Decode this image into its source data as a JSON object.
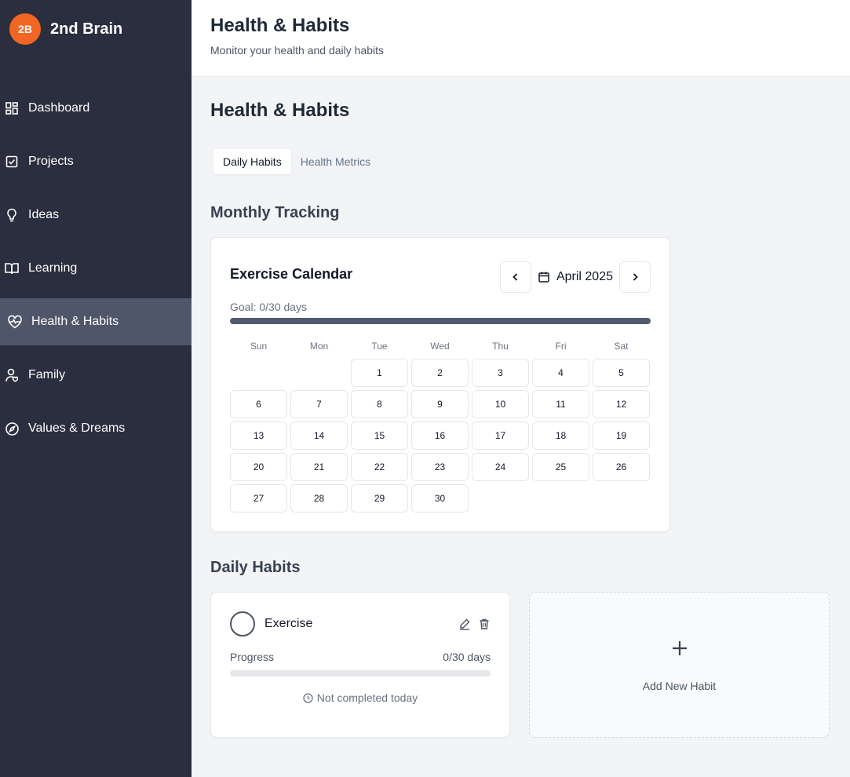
{
  "brand": {
    "logo_text": "2B",
    "name": "2nd Brain",
    "logo_color": "#f26522"
  },
  "sidebar": {
    "items": [
      {
        "label": "Dashboard",
        "icon": "dashboard-icon",
        "active": false
      },
      {
        "label": "Projects",
        "icon": "check-square-icon",
        "active": false
      },
      {
        "label": "Ideas",
        "icon": "lightbulb-icon",
        "active": false
      },
      {
        "label": "Learning",
        "icon": "book-open-icon",
        "active": false
      },
      {
        "label": "Health & Habits",
        "icon": "heart-pulse-icon",
        "active": true
      },
      {
        "label": "Family",
        "icon": "user-heart-icon",
        "active": false
      },
      {
        "label": "Values & Dreams",
        "icon": "compass-icon",
        "active": false
      }
    ]
  },
  "header": {
    "title": "Health & Habits",
    "subtitle": "Monitor your health and daily habits"
  },
  "main": {
    "title": "Health & Habits",
    "tabs": [
      {
        "label": "Daily Habits",
        "active": true
      },
      {
        "label": "Health Metrics",
        "active": false
      }
    ],
    "monthly_section_title": "Monthly Tracking",
    "daily_section_title": "Daily Habits"
  },
  "calendar": {
    "title": "Exercise Calendar",
    "month_label": "April 2025",
    "goal_text": "Goal: 0/30 days",
    "goal_progress": 1.0,
    "weekdays": [
      "Sun",
      "Mon",
      "Tue",
      "Wed",
      "Thu",
      "Fri",
      "Sat"
    ],
    "days": [
      "",
      "",
      "1",
      "2",
      "3",
      "4",
      "5",
      "6",
      "7",
      "8",
      "9",
      "10",
      "11",
      "12",
      "13",
      "14",
      "15",
      "16",
      "17",
      "18",
      "19",
      "20",
      "21",
      "22",
      "23",
      "24",
      "25",
      "26",
      "27",
      "28",
      "29",
      "30"
    ]
  },
  "habit": {
    "name": "Exercise",
    "progress_label": "Progress",
    "progress_count": "0/30 days",
    "progress": 0,
    "status": "Not completed today"
  },
  "add_habit": {
    "label": "Add New Habit"
  },
  "colors": {
    "sidebar_bg": "#2a2e3e",
    "sidebar_active": "#4f5669",
    "progress_fill": "#525a6e"
  }
}
